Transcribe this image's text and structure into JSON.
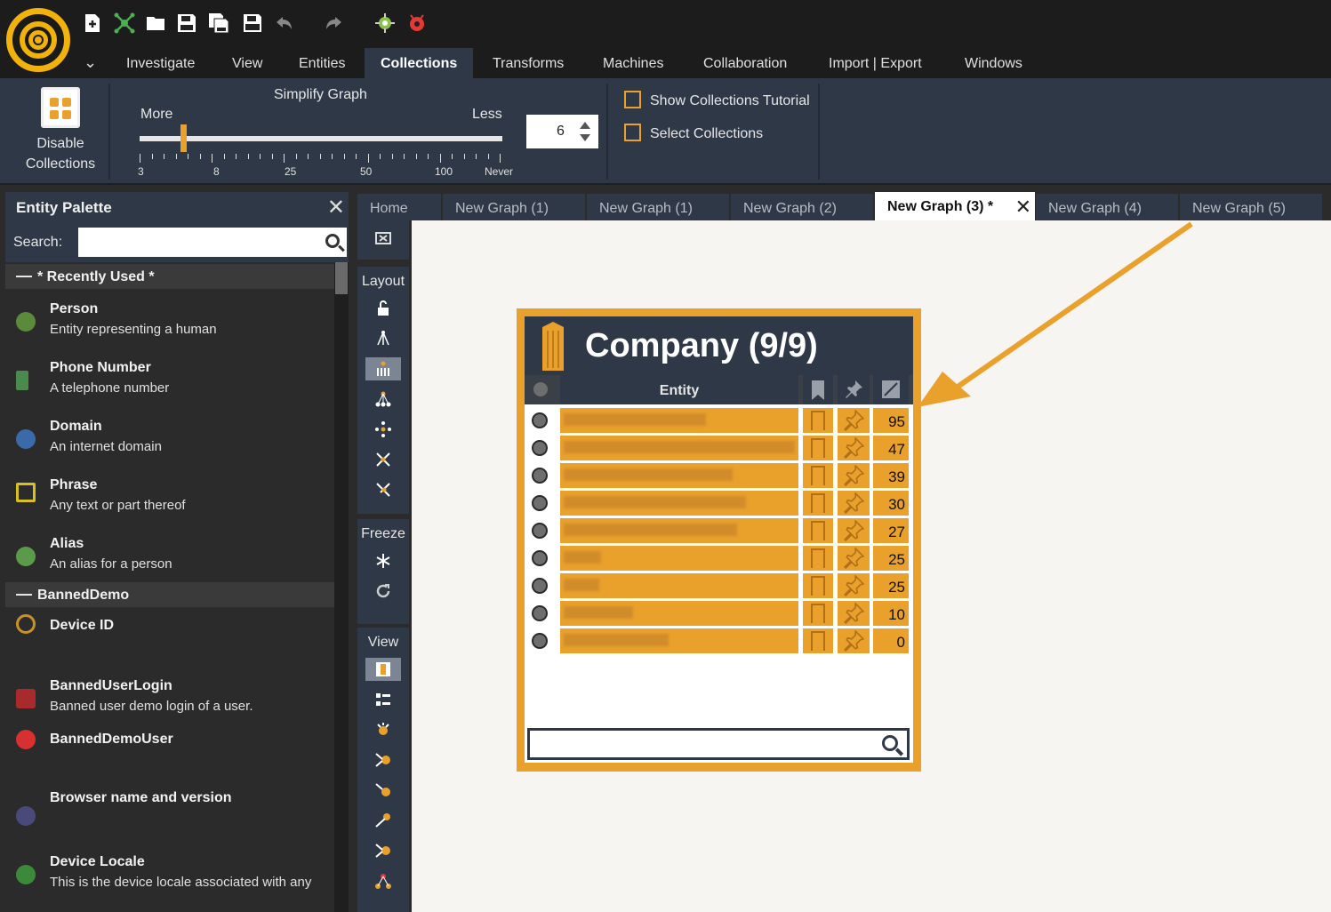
{
  "menu": {
    "tabs": [
      {
        "label": "Investigate"
      },
      {
        "label": "View"
      },
      {
        "label": "Entities"
      },
      {
        "label": "Collections"
      },
      {
        "label": "Transforms"
      },
      {
        "label": "Machines"
      },
      {
        "label": "Collaboration"
      },
      {
        "label": "Import | Export"
      },
      {
        "label": "Windows"
      }
    ],
    "active_tab": "Collections"
  },
  "ribbon": {
    "disable_line1": "Disable",
    "disable_line2": "Collections",
    "simplify_title": "Simplify Graph",
    "more_label": "More",
    "less_label": "Less",
    "tick_labels": [
      "3",
      "8",
      "25",
      "50",
      "100",
      "Never"
    ],
    "slider_position_fraction": 0.12,
    "spinner_value": "6",
    "show_tutorial": "Show Collections Tutorial",
    "select_collections": "Select Collections"
  },
  "palette": {
    "title": "Entity Palette",
    "search_label": "Search:",
    "search_value": "",
    "groups": [
      {
        "label": "* Recently Used *",
        "items": [
          {
            "name": "Person",
            "desc": "Entity representing a human",
            "icon": "person-icon",
            "color": "#5a8a3a"
          },
          {
            "name": "Phone Number",
            "desc": "A telephone number",
            "icon": "phone-icon",
            "color": "#4a8a4a"
          },
          {
            "name": "Domain",
            "desc": "An internet domain",
            "icon": "globe-icon",
            "color": "#3a6aaa"
          },
          {
            "name": "Phrase",
            "desc": "Any text or part thereof",
            "icon": "speech-bubble-icon",
            "color": "#d8c020"
          },
          {
            "name": "Alias",
            "desc": "An alias for a person",
            "icon": "alias-icon",
            "color": "#5a9a4a"
          }
        ]
      },
      {
        "label": "BannedDemo",
        "items": [
          {
            "name": "Device ID",
            "desc": "",
            "icon": "magnifier-icon",
            "color": "#c8902a"
          },
          {
            "name": "BannedUserLogin",
            "desc": "Banned user demo login of a user.",
            "icon": "gate-icon",
            "color": "#a82a2a"
          },
          {
            "name": "BannedDemoUser",
            "desc": "",
            "icon": "user-badge-icon",
            "color": "#d83030"
          },
          {
            "name": "Browser name and version",
            "desc": "",
            "icon": "browser-globe-icon",
            "color": "#4a4a7a"
          },
          {
            "name": "Device Locale",
            "desc": "This is the device locale associated with any",
            "icon": "locale-globe-icon",
            "color": "#3a8a3a"
          }
        ]
      }
    ]
  },
  "tools": {
    "layout_label": "Layout",
    "freeze_label": "Freeze",
    "view_label": "View"
  },
  "graph_tabs": [
    {
      "label": "Home"
    },
    {
      "label": "New Graph (1)"
    },
    {
      "label": "New Graph (1)"
    },
    {
      "label": "New Graph (2)"
    },
    {
      "label": "New Graph (3) *"
    },
    {
      "label": "New Graph (4)"
    },
    {
      "label": "New Graph (5)"
    }
  ],
  "active_graph_tab": "New Graph (3) *",
  "collection": {
    "title": "Company (9/9)",
    "entity_column": "Entity",
    "counts": [
      "95",
      "47",
      "39",
      "30",
      "27",
      "25",
      "25",
      "10",
      "0"
    ],
    "search_value": ""
  },
  "colors": {
    "accent": "#e9a12c",
    "ribbon_bg": "#2e3847",
    "canvas_bg": "#f6f5f1"
  }
}
